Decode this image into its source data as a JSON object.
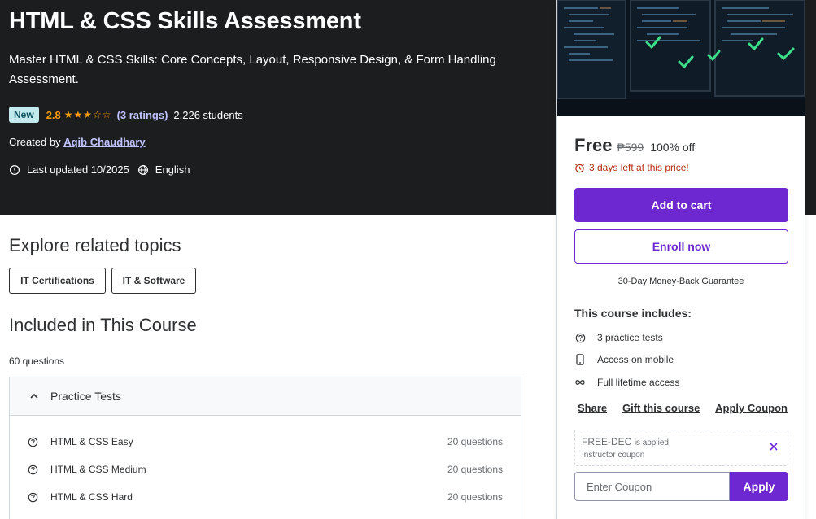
{
  "course": {
    "title": "HTML & CSS Skills Assessment",
    "subtitle": "Master HTML & CSS Skills: Core Concepts, Layout, Responsive Design, & Form Handling Assessment.",
    "badge": "New",
    "rating": "2.8",
    "stars_value": 2.8,
    "ratings_link": "(3 ratings)",
    "students": "2,226 students",
    "created_by_label": "Created by",
    "author": "Aqib Chaudhary",
    "last_updated": "Last updated 10/2025",
    "language": "English"
  },
  "sidebar": {
    "price": "Free",
    "original_price": "₱599",
    "discount": "100% off",
    "timer": "3 days left at this price!",
    "add_to_cart": "Add to cart",
    "enroll_now": "Enroll now",
    "guarantee": "30-Day Money-Back Guarantee",
    "includes_title": "This course includes:",
    "includes": [
      {
        "icon": "question-circle-icon",
        "label": "3 practice tests"
      },
      {
        "icon": "mobile-icon",
        "label": "Access on mobile"
      },
      {
        "icon": "infinity-icon",
        "label": "Full lifetime access"
      }
    ],
    "share": "Share",
    "gift": "Gift this course",
    "apply_coupon": "Apply Coupon",
    "coupon_code": "FREE-DEC",
    "coupon_applied": "is applied",
    "coupon_type": "Instructor coupon",
    "coupon_placeholder": "Enter Coupon",
    "apply": "Apply"
  },
  "main": {
    "related_heading": "Explore related topics",
    "topics": [
      "IT Certifications",
      "IT & Software"
    ],
    "included_heading": "Included in This Course",
    "question_count": "60 questions",
    "section_title": "Practice Tests",
    "tests": [
      {
        "name": "HTML & CSS Easy",
        "count": "20 questions"
      },
      {
        "name": "HTML & CSS Medium",
        "count": "20 questions"
      },
      {
        "name": "HTML & CSS Hard",
        "count": "20 questions"
      }
    ]
  },
  "colors": {
    "hero_bg": "#1c1d1f",
    "accent": "#6d28d2",
    "star": "#f69c08",
    "timer": "#b32d0f",
    "badge_bg": "#c2e9eb"
  }
}
